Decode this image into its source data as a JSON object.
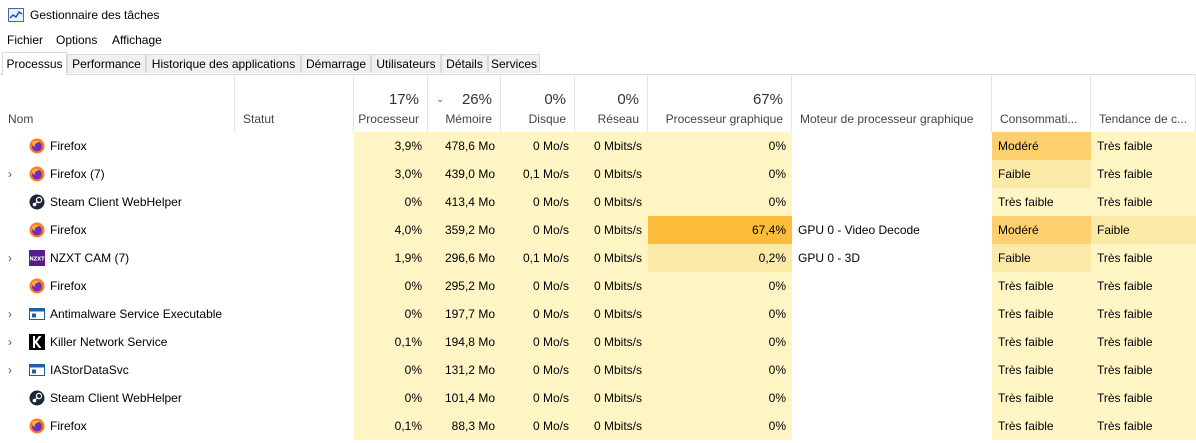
{
  "window": {
    "title": "Gestionnaire des tâches"
  },
  "menu": [
    "Fichier",
    "Options",
    "Affichage"
  ],
  "tabs": [
    "Processus",
    "Performance",
    "Historique des applications",
    "Démarrage",
    "Utilisateurs",
    "Détails",
    "Services"
  ],
  "columns": {
    "name": "Nom",
    "status": "Statut",
    "cpu": {
      "pct": "17%",
      "label": "Processeur"
    },
    "memory": {
      "pct": "26%",
      "label": "Mémoire"
    },
    "disk": {
      "pct": "0%",
      "label": "Disque"
    },
    "network": {
      "pct": "0%",
      "label": "Réseau"
    },
    "gpu": {
      "pct": "67%",
      "label": "Processeur graphique"
    },
    "gpu_engine": "Moteur de processeur graphique",
    "power": "Consommati...",
    "power_trend": "Tendance de c..."
  },
  "rows": [
    {
      "icon": "firefox-icon",
      "expandable": false,
      "name": "Firefox",
      "cpu": "3,9%",
      "memory": "478,6 Mo",
      "disk": "0 Mo/s",
      "network": "0 Mbits/s",
      "gpu": "0%",
      "gpu_engine": "",
      "power": "Modéré",
      "trend": "Très faible"
    },
    {
      "icon": "firefox-icon",
      "expandable": true,
      "name": "Firefox (7)",
      "cpu": "3,0%",
      "memory": "439,0 Mo",
      "disk": "0,1 Mo/s",
      "network": "0 Mbits/s",
      "gpu": "0%",
      "gpu_engine": "",
      "power": "Faible",
      "trend": "Très faible"
    },
    {
      "icon": "steam-icon",
      "expandable": false,
      "name": "Steam Client WebHelper",
      "cpu": "0%",
      "memory": "413,4 Mo",
      "disk": "0 Mo/s",
      "network": "0 Mbits/s",
      "gpu": "0%",
      "gpu_engine": "",
      "power": "Très faible",
      "trend": "Très faible"
    },
    {
      "icon": "firefox-icon",
      "expandable": false,
      "name": "Firefox",
      "cpu": "4,0%",
      "memory": "359,2 Mo",
      "disk": "0 Mo/s",
      "network": "0 Mbits/s",
      "gpu": "67,4%",
      "gpu_engine": "GPU 0 - Video Decode",
      "power": "Modéré",
      "trend": "Faible"
    },
    {
      "icon": "nzxt-icon",
      "expandable": true,
      "name": "NZXT CAM (7)",
      "cpu": "1,9%",
      "memory": "296,6 Mo",
      "disk": "0,1 Mo/s",
      "network": "0 Mbits/s",
      "gpu": "0,2%",
      "gpu_engine": "GPU 0 - 3D",
      "power": "Faible",
      "trend": "Très faible"
    },
    {
      "icon": "firefox-icon",
      "expandable": false,
      "name": "Firefox",
      "cpu": "0%",
      "memory": "295,2 Mo",
      "disk": "0 Mo/s",
      "network": "0 Mbits/s",
      "gpu": "0%",
      "gpu_engine": "",
      "power": "Très faible",
      "trend": "Très faible"
    },
    {
      "icon": "service-icon",
      "expandable": true,
      "name": "Antimalware Service Executable",
      "cpu": "0%",
      "memory": "197,7 Mo",
      "disk": "0 Mo/s",
      "network": "0 Mbits/s",
      "gpu": "0%",
      "gpu_engine": "",
      "power": "Très faible",
      "trend": "Très faible"
    },
    {
      "icon": "killer-icon",
      "expandable": true,
      "name": "Killer Network Service",
      "cpu": "0,1%",
      "memory": "194,8 Mo",
      "disk": "0 Mo/s",
      "network": "0 Mbits/s",
      "gpu": "0%",
      "gpu_engine": "",
      "power": "Très faible",
      "trend": "Très faible"
    },
    {
      "icon": "service-icon",
      "expandable": true,
      "name": "IAStorDataSvc",
      "cpu": "0%",
      "memory": "131,2 Mo",
      "disk": "0 Mo/s",
      "network": "0 Mbits/s",
      "gpu": "0%",
      "gpu_engine": "",
      "power": "Très faible",
      "trend": "Très faible"
    },
    {
      "icon": "steam-icon",
      "expandable": false,
      "name": "Steam Client WebHelper",
      "cpu": "0%",
      "memory": "101,4 Mo",
      "disk": "0 Mo/s",
      "network": "0 Mbits/s",
      "gpu": "0%",
      "gpu_engine": "",
      "power": "Très faible",
      "trend": "Très faible"
    },
    {
      "icon": "firefox-icon",
      "expandable": false,
      "name": "Firefox",
      "cpu": "0,1%",
      "memory": "88,3 Mo",
      "disk": "0 Mo/s",
      "network": "0 Mbits/s",
      "gpu": "0%",
      "gpu_engine": "",
      "power": "Très faible",
      "trend": "Très faible"
    }
  ],
  "colors": {
    "heat_light": "#fff4c4",
    "heat_mid": "#fbe9a7",
    "heat_high": "#fdbd3b",
    "heat_warm": "#fecf6e"
  }
}
